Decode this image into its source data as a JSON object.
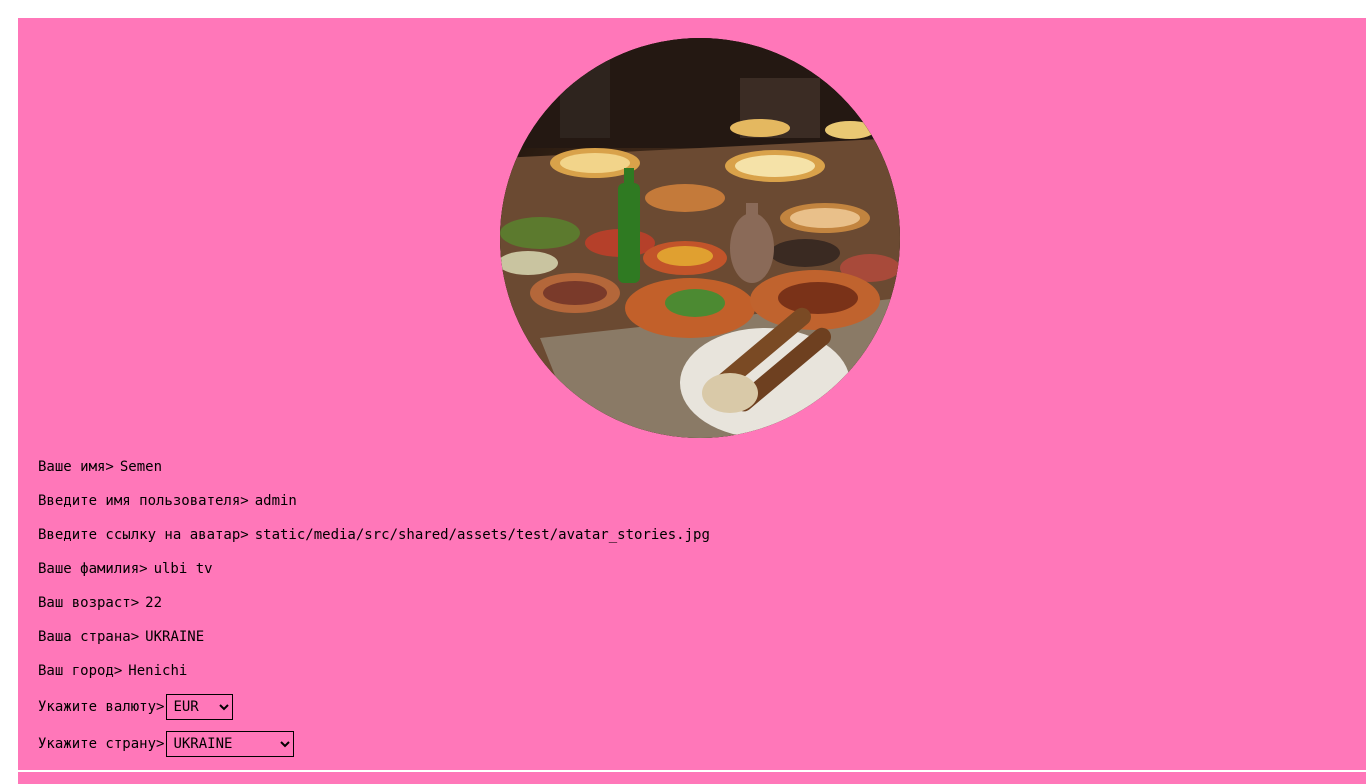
{
  "theme": {
    "card_bg": "#ff77b9",
    "page_bg": "#ffffff"
  },
  "avatar": {
    "icon": "food-table-photo"
  },
  "profile": {
    "fields": [
      {
        "label": "Ваше имя>",
        "value": "Semen"
      },
      {
        "label": "Введите имя пользователя>",
        "value": "admin"
      },
      {
        "label": "Введите ссылку на аватар>",
        "value": "static/media/src/shared/assets/test/avatar_stories.jpg"
      },
      {
        "label": "Ваше фамилия>",
        "value": "ulbi tv"
      },
      {
        "label": "Ваш возраст>",
        "value": "22"
      },
      {
        "label": "Ваша страна>",
        "value": "UKRAINE"
      },
      {
        "label": "Ваш город>",
        "value": "Henichi"
      }
    ],
    "currency": {
      "label": "Укажите валюту>",
      "selected": "EUR"
    },
    "country": {
      "label": "Укажите страну>",
      "selected": "UKRAINE"
    }
  }
}
